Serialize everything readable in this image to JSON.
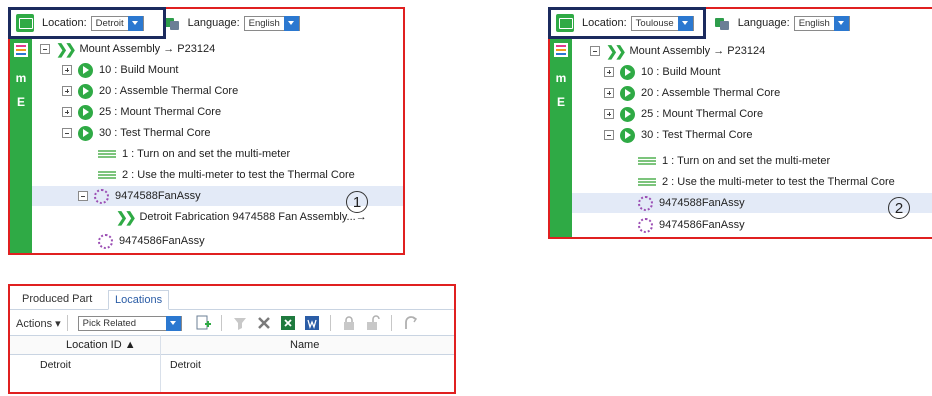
{
  "panel1": {
    "location_label": "Location:",
    "location_value": "Detroit",
    "language_label": "Language:",
    "language_value": "English",
    "tree": {
      "root": "Mount Assembly → P23124",
      "ops": [
        "10 : Build Mount",
        "20 : Assemble Thermal Core",
        "25 : Mount Thermal Core",
        "30 : Test Thermal Core"
      ],
      "steps": [
        "1 : Turn on and set the multi-meter",
        "2 : Use the multi-meter to test the Thermal Core"
      ],
      "part_selected": "9474588FanAssy",
      "fabrication": "Detroit Fabrication 9474588 Fan Assembly...→",
      "part2": "9474586FanAssy"
    },
    "callout": "1"
  },
  "panel2": {
    "location_label": "Location:",
    "location_value": "Toulouse",
    "language_label": "Language:",
    "language_value": "English",
    "tree": {
      "root": "Mount Assembly → P23124",
      "ops": [
        "10 : Build Mount",
        "20 : Assemble Thermal Core",
        "25 : Mount Thermal Core",
        "30 : Test Thermal Core"
      ],
      "steps": [
        "1 : Turn on and set the multi-meter",
        "2 : Use the multi-meter to test the Thermal Core"
      ],
      "part_selected": "9474588FanAssy",
      "part2": "9474586FanAssy"
    },
    "callout": "2"
  },
  "grid": {
    "tabs": [
      "Produced Part",
      "Locations"
    ],
    "actions_label": "Actions ▾",
    "pick_value": "Pick Related",
    "headers": {
      "location_id": "Location ID ▲",
      "name": "Name"
    },
    "rows": [
      {
        "location_id": "Detroit",
        "name": "Detroit"
      }
    ]
  },
  "colors": {
    "accent_green": "#2faa45",
    "highlight_red": "#e02020",
    "focus_navy": "#1b2a5e",
    "selection": "#e3eaf7"
  }
}
